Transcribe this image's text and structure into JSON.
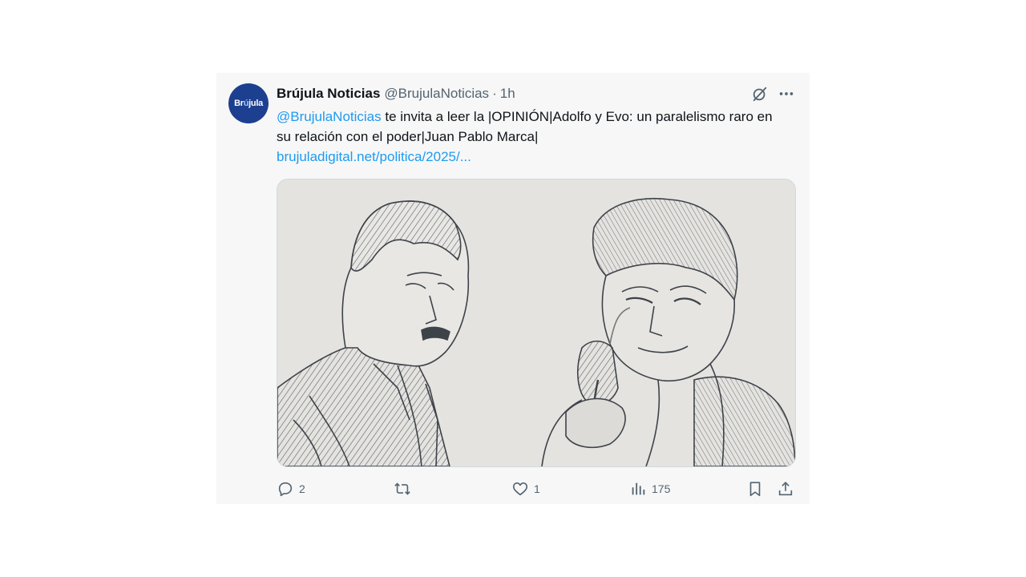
{
  "tweet": {
    "avatar_text_main": "Br",
    "avatar_text_accent": "ú",
    "avatar_text_rest": "jula",
    "display_name": "Brújula Noticias",
    "handle": "@BrujulaNoticias",
    "separator": "·",
    "time": "1h",
    "mention": "@BrujulaNoticias",
    "body_text": " te invita a leer la |OPINIÓN|Adolfo y Evo: un paralelismo raro en su relación con el poder|Juan Pablo Marca|",
    "link": "brujuladigital.net/politica/2025/..."
  },
  "actions": {
    "replies": "2",
    "likes": "1",
    "views": "175"
  },
  "icons": {
    "grok": "grok-icon",
    "more": "more-icon",
    "reply": "reply-icon",
    "retweet": "retweet-icon",
    "like": "heart-icon",
    "views": "analytics-icon",
    "bookmark": "bookmark-icon",
    "share": "share-icon"
  },
  "colors": {
    "link": "#1d9bf0",
    "text": "#0f1419",
    "muted": "#536471",
    "avatar_bg": "#1d3f8f",
    "card_bg": "#f7f7f7"
  }
}
